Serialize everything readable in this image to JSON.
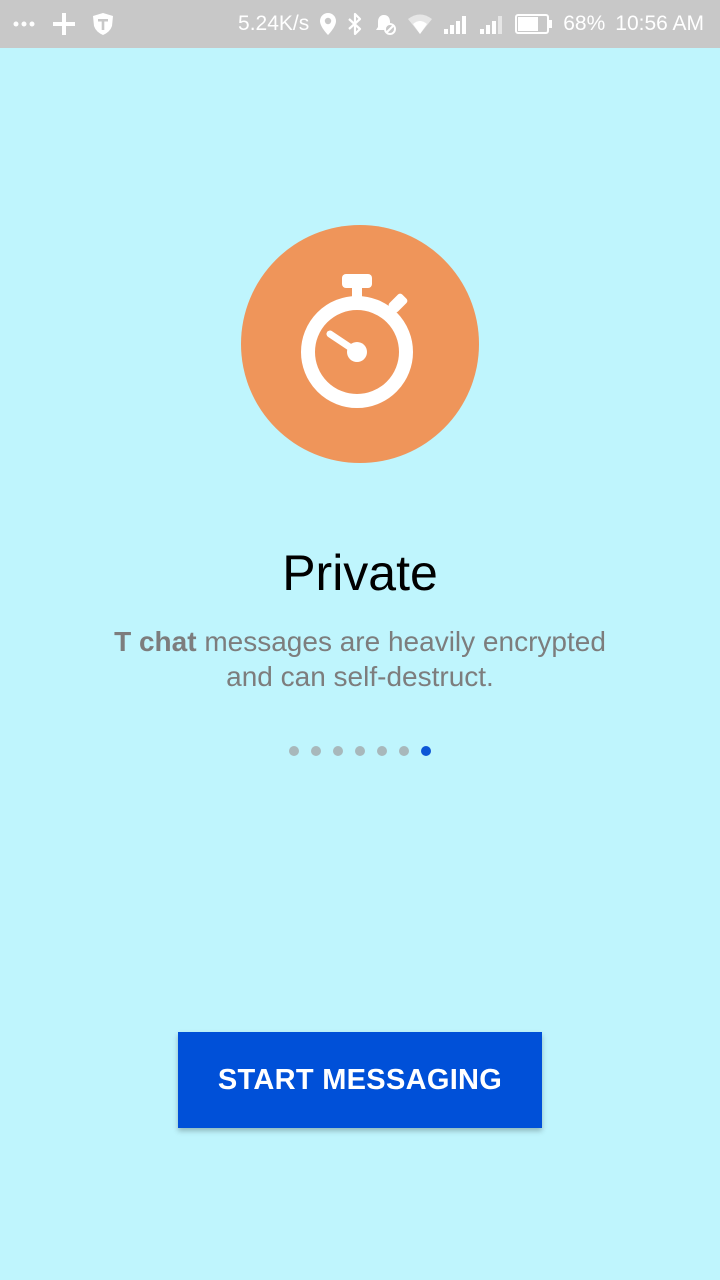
{
  "status_bar": {
    "left_icons": [
      "more-dots-icon",
      "plus-icon",
      "shield-t-icon"
    ],
    "network_speed": "5.24K/s",
    "right_icons": [
      "location-icon",
      "bluetooth-icon",
      "alarm-icon",
      "wifi-icon",
      "signal-1-icon",
      "signal-2-icon",
      "battery-icon"
    ],
    "battery": "68%",
    "time": "10:56 AM"
  },
  "hero": {
    "icon": "stopwatch-icon",
    "circle_color": "#EF955A"
  },
  "content": {
    "title": "Private",
    "subtitle_brand": "T chat",
    "subtitle_line1_rest": " messages are heavily encrypted",
    "subtitle_line2": "and can self-destruct."
  },
  "pager": {
    "total": 7,
    "active_index": 6,
    "active_color": "#0D56D6",
    "inactive_color": "#A8B8BB"
  },
  "actions": {
    "start_label": "START MESSAGING",
    "button_color": "#0050D8"
  },
  "theme": {
    "background": "#BFF5FD",
    "status_bar_bg": "#C8C8C8"
  }
}
